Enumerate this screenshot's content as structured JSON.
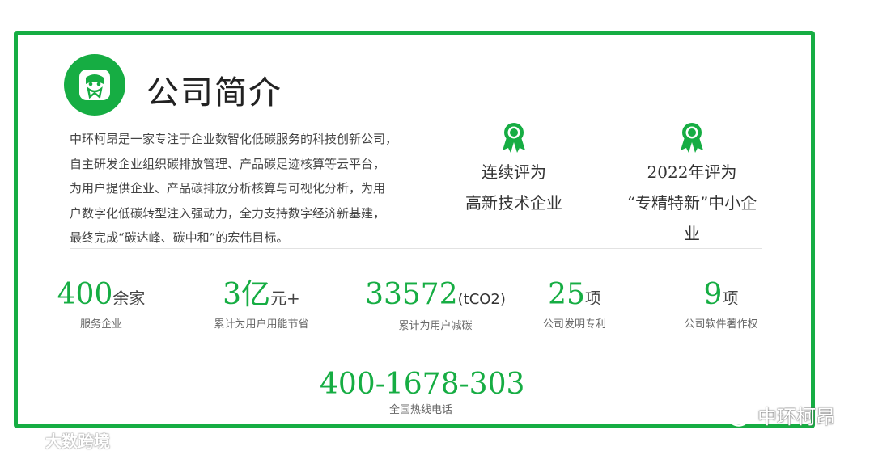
{
  "title": "公司简介",
  "intro_lines": [
    "中环柯昂是一家专注于企业数智化低碳服务的科技创新公司，",
    "自主研发企业组织碳排放管理、产品碳足迹核算等云平台，",
    "为用户提供企业、产品碳排放分析核算与可视化分析，为用",
    "户数字化低碳转型注入强动力，全力支持数字经济新基建，",
    "最终完成“碳达峰、碳中和”的宏伟目标。"
  ],
  "awards": [
    {
      "icon": "award-medal-icon",
      "lines": [
        "连续评为",
        "高新技术企业"
      ]
    },
    {
      "icon": "award-medal-icon",
      "lines": [
        "2022年评为",
        "“专精特新”中小企",
        "业"
      ]
    }
  ],
  "stats": [
    {
      "value": "400",
      "unit": "余家",
      "label": "服务企业"
    },
    {
      "value": "3亿",
      "unit": "元+",
      "label": "累计为用户用能节省"
    },
    {
      "value": "33572",
      "unit": "(tCO2)",
      "label": "累计为用户减碳"
    },
    {
      "value": "25",
      "unit": "项",
      "label": "公司发明专利"
    },
    {
      "value": "9",
      "unit": "项",
      "label": "公司软件著作权"
    }
  ],
  "hotline": {
    "number": "400-1678-303",
    "label": "全国热线电话"
  },
  "watermarks": {
    "left": "大数跨境",
    "right": "中环柯昂"
  },
  "colors": {
    "accent": "#16ad43"
  }
}
